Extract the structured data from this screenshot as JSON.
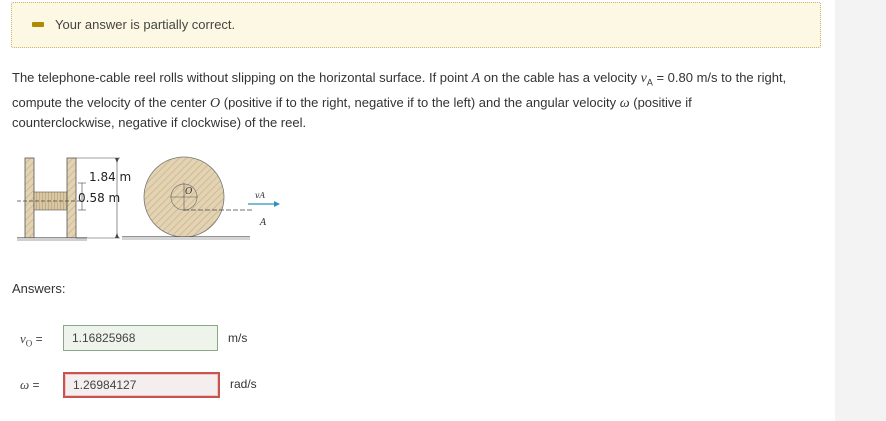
{
  "status": {
    "message": "Your answer is partially correct.",
    "color": "#b08a00"
  },
  "question": {
    "text_1": "The telephone-cable reel rolls without slipping on the horizontal surface. If point ",
    "point_a": "A",
    "text_2": " on the cable has a velocity ",
    "v_sym": "v",
    "v_sub": "A",
    "text_3": " = 0.80 m/s to the right,",
    "text_4": "compute the velocity of the center ",
    "center_o": "O",
    "text_5": " (positive if to the right, negative if to the left) and the angular velocity ",
    "omega": "ω",
    "text_6": " (positive if",
    "text_7": "counterclockwise, negative if clockwise) of the reel."
  },
  "figure": {
    "dim_outer": "1.84 m",
    "dim_inner": "0.58 m",
    "label_O": "O",
    "label_vA": "vA",
    "label_A": "A"
  },
  "answers": {
    "heading": "Answers:",
    "v0": {
      "symbol": "v",
      "subscript": "O",
      "equals": " =",
      "value": "1.16825968",
      "unit": "m/s",
      "state": "correct"
    },
    "omega": {
      "symbol": "ω",
      "equals": " =",
      "value": "1.26984127",
      "unit": "rad/s",
      "state": "incorrect"
    }
  }
}
